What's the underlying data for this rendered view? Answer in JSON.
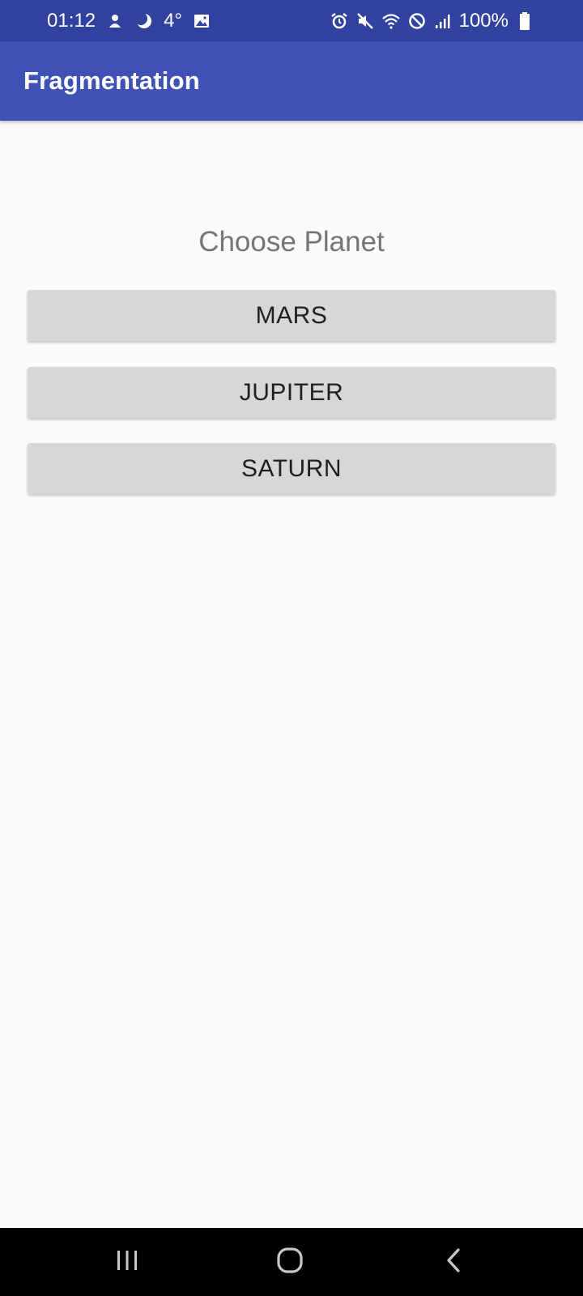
{
  "status_bar": {
    "time": "01:12",
    "temperature": "4°",
    "battery": "100%",
    "icons_left": [
      "app-notification-icon",
      "moon-icon",
      "image-icon"
    ],
    "icons_right": [
      "alarm-icon",
      "mute-icon",
      "wifi-icon",
      "dnd-icon",
      "signal-icon",
      "battery-icon"
    ]
  },
  "app_bar": {
    "title": "Fragmentation"
  },
  "main": {
    "heading": "Choose Planet",
    "buttons": [
      {
        "label": "MARS"
      },
      {
        "label": "JUPITER"
      },
      {
        "label": "SATURN"
      }
    ]
  },
  "nav_bar": {
    "icons": [
      "recents-icon",
      "home-icon",
      "back-icon"
    ]
  },
  "colors": {
    "status_bar": "#3041a0",
    "app_bar": "#3f51b5",
    "background": "#fafafa",
    "button": "#d6d7d7",
    "heading_text": "#757575",
    "nav_bar": "#000000"
  }
}
